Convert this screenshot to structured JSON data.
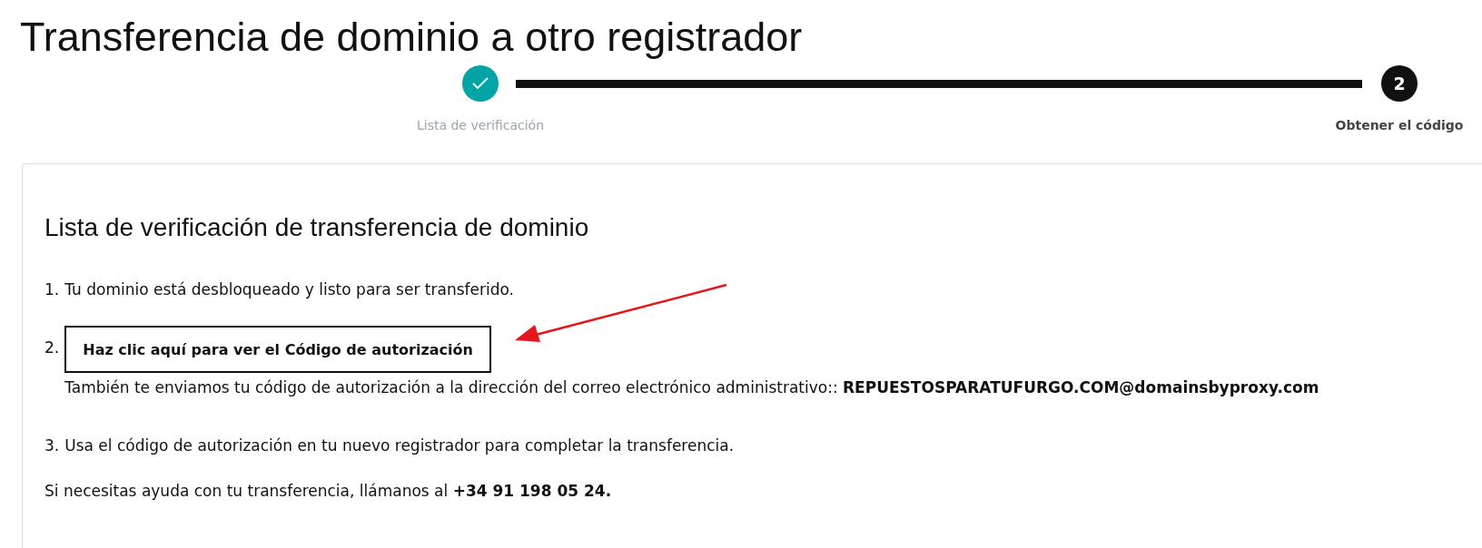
{
  "title": "Transferencia de dominio a otro registrador",
  "steps": [
    {
      "label": "Lista de verificación",
      "done": true,
      "selected": false
    },
    {
      "number": "2",
      "label": "Obtener el código",
      "done": false,
      "selected": true
    }
  ],
  "card": {
    "heading": "Lista de verificación de transferencia de dominio",
    "items": [
      {
        "marker": "1.",
        "kind": "text",
        "text": "Tu dominio está desbloqueado y listo para ser transferido."
      },
      {
        "marker": "2.",
        "kind": "button",
        "button": "Haz clic aquí para ver el Código de autorización",
        "note": "También te enviamos tu código de autorización a la dirección del correo electrónico administrativo:: **REPUESTOSPARATUFURGO.COM@domainsbyproxy.com**"
      },
      {
        "marker": "3.",
        "kind": "text",
        "text": "Usa el código de autorización en tu nuevo registrador para completar la transferencia."
      }
    ],
    "help": "Si necesitas ayuda con tu transferencia, llámanos al **+34 91 198 05 24.**"
  }
}
